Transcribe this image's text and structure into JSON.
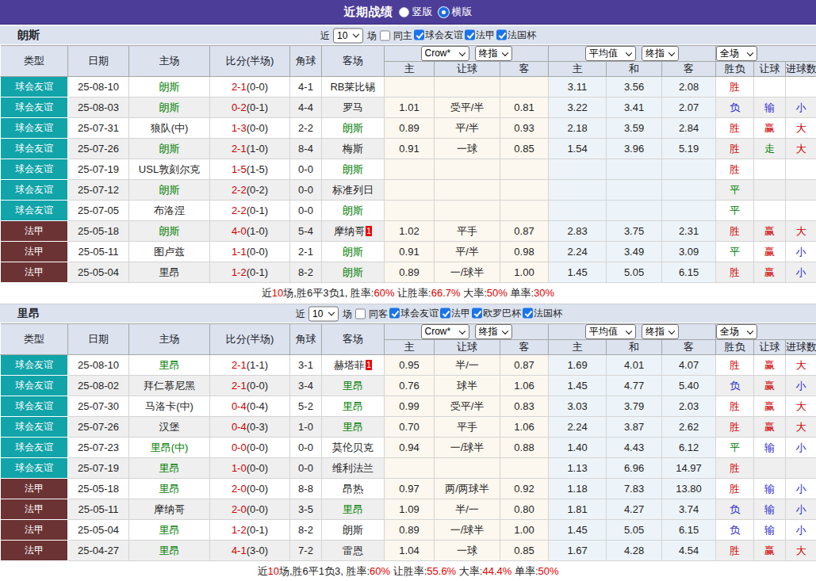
{
  "titlebar": {
    "title": "近期战绩",
    "view_options": [
      {
        "label": "竖版",
        "selected": false
      },
      {
        "label": "横版",
        "selected": true
      }
    ]
  },
  "table": {
    "headers_left": [
      "类型",
      "日期",
      "主场",
      "比分(半场)",
      "角球",
      "客场"
    ],
    "group1_selects": [
      "Crow*",
      "终指"
    ],
    "group1_labels": [
      "主",
      "让球",
      "客"
    ],
    "group2_selects": [
      "平均值",
      "终指"
    ],
    "group2_labels": [
      "主",
      "和",
      "客"
    ],
    "group3_selects": [
      "全场"
    ],
    "group3_labels": [
      "胜负",
      "让球",
      "进球数"
    ]
  },
  "filter_labels": {
    "recent": "近",
    "matches": "场",
    "count_value": "10"
  },
  "colors": {
    "accent_purple": "#4c3d99",
    "friendly_teal": "#11a4a9",
    "league_maroon": "#6c3334",
    "win_red": "#cf0000",
    "draw_green": "#008000",
    "lose_blue": "#2a2ad0",
    "highlight_team_green": "#008000",
    "rank_badge_red": "#ee0000",
    "checkbox_blue": "#1a73e8"
  },
  "sections": [
    {
      "team": "朗斯",
      "filters": {
        "same_label": "同主",
        "same_checked": false,
        "leagues": [
          {
            "label": "球会友谊",
            "checked": true
          },
          {
            "label": "法甲",
            "checked": true
          },
          {
            "label": "法国杯",
            "checked": true
          }
        ]
      },
      "rows": [
        {
          "type": "球会友谊",
          "type_key": "friendly",
          "date": "25-08-10",
          "home": "朗斯",
          "home_hl": true,
          "home_rank": "",
          "ft": "2-1",
          "ht": "(0-0)",
          "corner": "4-1",
          "away": "RB莱比锡",
          "away_hl": false,
          "away_rank": "",
          "ah": [
            "",
            "",
            ""
          ],
          "eu": [
            "3.11",
            "3.56",
            "2.08"
          ],
          "res": "胜",
          "res_k": "r",
          "ah_res": "",
          "ah_res_k": "",
          "ou_res": "",
          "ou_res_k": ""
        },
        {
          "type": "球会友谊",
          "type_key": "friendly",
          "date": "25-08-03",
          "home": "朗斯",
          "home_hl": true,
          "home_rank": "",
          "ft": "0-2",
          "ht": "(0-1)",
          "corner": "4-4",
          "away": "罗马",
          "away_hl": false,
          "away_rank": "",
          "ah": [
            "1.01",
            "受平/半",
            "0.81"
          ],
          "eu": [
            "3.22",
            "3.41",
            "2.07"
          ],
          "res": "负",
          "res_k": "b",
          "ah_res": "输",
          "ah_res_k": "b",
          "ou_res": "小",
          "ou_res_k": "b"
        },
        {
          "type": "球会友谊",
          "type_key": "friendly",
          "date": "25-07-31",
          "home": "狼队(中)",
          "home_hl": false,
          "home_rank": "",
          "ft": "1-3",
          "ht": "(0-0)",
          "corner": "2-2",
          "away": "朗斯",
          "away_hl": true,
          "away_rank": "",
          "ah": [
            "0.89",
            "平/半",
            "0.93"
          ],
          "eu": [
            "2.18",
            "3.59",
            "2.84"
          ],
          "res": "胜",
          "res_k": "r",
          "ah_res": "赢",
          "ah_res_k": "r",
          "ou_res": "大",
          "ou_res_k": "r"
        },
        {
          "type": "球会友谊",
          "type_key": "friendly",
          "date": "25-07-26",
          "home": "朗斯",
          "home_hl": true,
          "home_rank": "",
          "ft": "2-1",
          "ht": "(1-0)",
          "corner": "8-4",
          "away": "梅斯",
          "away_hl": false,
          "away_rank": "",
          "ah": [
            "0.91",
            "一球",
            "0.85"
          ],
          "eu": [
            "1.54",
            "3.96",
            "5.19"
          ],
          "res": "胜",
          "res_k": "r",
          "ah_res": "走",
          "ah_res_k": "g",
          "ou_res": "大",
          "ou_res_k": "r"
        },
        {
          "type": "球会友谊",
          "type_key": "friendly",
          "date": "25-07-19",
          "home": "USL敦刻尔克",
          "home_hl": false,
          "home_rank": "",
          "ft": "1-5",
          "ht": "(1-5)",
          "corner": "0-0",
          "away": "朗斯",
          "away_hl": true,
          "away_rank": "",
          "ah": [
            "",
            "",
            ""
          ],
          "eu": [
            "",
            "",
            ""
          ],
          "res": "胜",
          "res_k": "r",
          "ah_res": "",
          "ah_res_k": "",
          "ou_res": "",
          "ou_res_k": ""
        },
        {
          "type": "球会友谊",
          "type_key": "friendly",
          "date": "25-07-12",
          "home": "朗斯",
          "home_hl": true,
          "home_rank": "",
          "ft": "2-2",
          "ht": "(0-2)",
          "corner": "0-0",
          "away": "标准列日",
          "away_hl": false,
          "away_rank": "",
          "ah": [
            "",
            "",
            ""
          ],
          "eu": [
            "",
            "",
            ""
          ],
          "res": "平",
          "res_k": "g",
          "ah_res": "",
          "ah_res_k": "",
          "ou_res": "",
          "ou_res_k": ""
        },
        {
          "type": "球会友谊",
          "type_key": "friendly",
          "date": "25-07-05",
          "home": "布洛涅",
          "home_hl": false,
          "home_rank": "",
          "ft": "2-2",
          "ht": "(0-1)",
          "corner": "0-0",
          "away": "朗斯",
          "away_hl": true,
          "away_rank": "",
          "ah": [
            "",
            "",
            ""
          ],
          "eu": [
            "",
            "",
            ""
          ],
          "res": "平",
          "res_k": "g",
          "ah_res": "",
          "ah_res_k": "",
          "ou_res": "",
          "ou_res_k": ""
        },
        {
          "type": "法甲",
          "type_key": "league",
          "date": "25-05-18",
          "home": "朗斯",
          "home_hl": true,
          "home_rank": "",
          "ft": "4-0",
          "ht": "(1-0)",
          "corner": "5-4",
          "away": "摩纳哥",
          "away_hl": false,
          "away_rank": "1",
          "ah": [
            "1.02",
            "平手",
            "0.87"
          ],
          "eu": [
            "2.83",
            "3.75",
            "2.31"
          ],
          "res": "胜",
          "res_k": "r",
          "ah_res": "赢",
          "ah_res_k": "r",
          "ou_res": "大",
          "ou_res_k": "r"
        },
        {
          "type": "法甲",
          "type_key": "league",
          "date": "25-05-11",
          "home": "图卢兹",
          "home_hl": false,
          "home_rank": "",
          "ft": "1-1",
          "ht": "(0-0)",
          "corner": "2-1",
          "away": "朗斯",
          "away_hl": true,
          "away_rank": "",
          "ah": [
            "0.91",
            "平/半",
            "0.98"
          ],
          "eu": [
            "2.24",
            "3.49",
            "3.09"
          ],
          "res": "平",
          "res_k": "g",
          "ah_res": "赢",
          "ah_res_k": "r",
          "ou_res": "小",
          "ou_res_k": "b"
        },
        {
          "type": "法甲",
          "type_key": "league",
          "date": "25-05-04",
          "home": "里昂",
          "home_hl": false,
          "home_rank": "",
          "ft": "1-2",
          "ht": "(0-1)",
          "corner": "8-2",
          "away": "朗斯",
          "away_hl": true,
          "away_rank": "",
          "ah": [
            "0.89",
            "一/球半",
            "1.00"
          ],
          "eu": [
            "1.45",
            "5.05",
            "6.15"
          ],
          "res": "胜",
          "res_k": "r",
          "ah_res": "赢",
          "ah_res_k": "r",
          "ou_res": "小",
          "ou_res_k": "b"
        }
      ],
      "summary": [
        {
          "text": "近",
          "red": false
        },
        {
          "text": "10",
          "red": true
        },
        {
          "text": "场,胜6平3负1, 胜率:",
          "red": false
        },
        {
          "text": "60%",
          "red": true
        },
        {
          "text": " 让胜率:",
          "red": false
        },
        {
          "text": "66.7%",
          "red": true
        },
        {
          "text": " 大率:",
          "red": false
        },
        {
          "text": "50%",
          "red": true
        },
        {
          "text": " 单率:",
          "red": false
        },
        {
          "text": "30%",
          "red": true
        }
      ]
    },
    {
      "team": "里昂",
      "filters": {
        "same_label": "同客",
        "same_checked": false,
        "leagues": [
          {
            "label": "球会友谊",
            "checked": true
          },
          {
            "label": "法甲",
            "checked": true
          },
          {
            "label": "欧罗巴杯",
            "checked": true
          },
          {
            "label": "法国杯",
            "checked": true
          }
        ]
      },
      "rows": [
        {
          "type": "球会友谊",
          "type_key": "friendly",
          "date": "25-08-10",
          "home": "里昂",
          "home_hl": true,
          "home_rank": "",
          "ft": "2-1",
          "ht": "(1-1)",
          "corner": "3-1",
          "away": "赫塔菲",
          "away_hl": false,
          "away_rank": "1",
          "ah": [
            "0.95",
            "半/一",
            "0.87"
          ],
          "eu": [
            "1.69",
            "4.01",
            "4.07"
          ],
          "res": "胜",
          "res_k": "r",
          "ah_res": "赢",
          "ah_res_k": "r",
          "ou_res": "大",
          "ou_res_k": "r"
        },
        {
          "type": "球会友谊",
          "type_key": "friendly",
          "date": "25-08-02",
          "home": "拜仁慕尼黑",
          "home_hl": false,
          "home_rank": "",
          "ft": "2-1",
          "ht": "(0-0)",
          "corner": "3-4",
          "away": "里昂",
          "away_hl": true,
          "away_rank": "",
          "ah": [
            "0.76",
            "球半",
            "1.06"
          ],
          "eu": [
            "1.45",
            "4.77",
            "5.40"
          ],
          "res": "负",
          "res_k": "b",
          "ah_res": "赢",
          "ah_res_k": "r",
          "ou_res": "小",
          "ou_res_k": "b"
        },
        {
          "type": "球会友谊",
          "type_key": "friendly",
          "date": "25-07-30",
          "home": "马洛卡(中)",
          "home_hl": false,
          "home_rank": "",
          "ft": "0-4",
          "ht": "(0-4)",
          "corner": "5-2",
          "away": "里昂",
          "away_hl": true,
          "away_rank": "",
          "ah": [
            "0.99",
            "受平/半",
            "0.83"
          ],
          "eu": [
            "3.03",
            "3.79",
            "2.03"
          ],
          "res": "胜",
          "res_k": "r",
          "ah_res": "赢",
          "ah_res_k": "r",
          "ou_res": "大",
          "ou_res_k": "r"
        },
        {
          "type": "球会友谊",
          "type_key": "friendly",
          "date": "25-07-26",
          "home": "汉堡",
          "home_hl": false,
          "home_rank": "",
          "ft": "0-4",
          "ht": "(0-3)",
          "corner": "1-0",
          "away": "里昂",
          "away_hl": true,
          "away_rank": "",
          "ah": [
            "0.70",
            "平手",
            "1.06"
          ],
          "eu": [
            "2.24",
            "3.87",
            "2.62"
          ],
          "res": "胜",
          "res_k": "r",
          "ah_res": "赢",
          "ah_res_k": "r",
          "ou_res": "大",
          "ou_res_k": "r"
        },
        {
          "type": "球会友谊",
          "type_key": "friendly",
          "date": "25-07-23",
          "home": "里昂(中)",
          "home_hl": true,
          "home_rank": "",
          "ft": "0-0",
          "ht": "(0-0)",
          "corner": "0-0",
          "away": "莫伦贝克",
          "away_hl": false,
          "away_rank": "",
          "ah": [
            "0.94",
            "一/球半",
            "0.88"
          ],
          "eu": [
            "1.40",
            "4.43",
            "6.12"
          ],
          "res": "平",
          "res_k": "g",
          "ah_res": "输",
          "ah_res_k": "b",
          "ou_res": "小",
          "ou_res_k": "b"
        },
        {
          "type": "球会友谊",
          "type_key": "friendly",
          "date": "25-07-19",
          "home": "里昂",
          "home_hl": true,
          "home_rank": "",
          "ft": "1-0",
          "ht": "(0-0)",
          "corner": "0-0",
          "away": "维利法兰",
          "away_hl": false,
          "away_rank": "",
          "ah": [
            "",
            "",
            ""
          ],
          "eu": [
            "1.13",
            "6.96",
            "14.97"
          ],
          "res": "胜",
          "res_k": "r",
          "ah_res": "",
          "ah_res_k": "",
          "ou_res": "",
          "ou_res_k": ""
        },
        {
          "type": "法甲",
          "type_key": "league",
          "date": "25-05-18",
          "home": "里昂",
          "home_hl": true,
          "home_rank": "",
          "ft": "2-0",
          "ht": "(0-0)",
          "corner": "8-8",
          "away": "昂热",
          "away_hl": false,
          "away_rank": "",
          "ah": [
            "0.97",
            "两/两球半",
            "0.92"
          ],
          "eu": [
            "1.18",
            "7.83",
            "13.80"
          ],
          "res": "胜",
          "res_k": "r",
          "ah_res": "输",
          "ah_res_k": "b",
          "ou_res": "小",
          "ou_res_k": "b"
        },
        {
          "type": "法甲",
          "type_key": "league",
          "date": "25-05-11",
          "home": "摩纳哥",
          "home_hl": false,
          "home_rank": "",
          "ft": "2-0",
          "ht": "(0-0)",
          "corner": "3-5",
          "away": "里昂",
          "away_hl": true,
          "away_rank": "",
          "ah": [
            "1.09",
            "半/一",
            "0.80"
          ],
          "eu": [
            "1.81",
            "4.27",
            "3.74"
          ],
          "res": "负",
          "res_k": "b",
          "ah_res": "输",
          "ah_res_k": "b",
          "ou_res": "小",
          "ou_res_k": "b"
        },
        {
          "type": "法甲",
          "type_key": "league",
          "date": "25-05-04",
          "home": "里昂",
          "home_hl": true,
          "home_rank": "",
          "ft": "1-2",
          "ht": "(0-1)",
          "corner": "8-2",
          "away": "朗斯",
          "away_hl": false,
          "away_rank": "",
          "ah": [
            "0.89",
            "一/球半",
            "1.00"
          ],
          "eu": [
            "1.45",
            "5.05",
            "6.15"
          ],
          "res": "负",
          "res_k": "b",
          "ah_res": "输",
          "ah_res_k": "b",
          "ou_res": "小",
          "ou_res_k": "b"
        },
        {
          "type": "法甲",
          "type_key": "league",
          "date": "25-04-27",
          "home": "里昂",
          "home_hl": true,
          "home_rank": "",
          "ft": "4-1",
          "ht": "(3-0)",
          "corner": "7-2",
          "away": "雷恩",
          "away_hl": false,
          "away_rank": "",
          "ah": [
            "1.04",
            "一球",
            "0.85"
          ],
          "eu": [
            "1.67",
            "4.28",
            "4.54"
          ],
          "res": "胜",
          "res_k": "r",
          "ah_res": "赢",
          "ah_res_k": "r",
          "ou_res": "大",
          "ou_res_k": "r"
        }
      ],
      "summary": [
        {
          "text": "近",
          "red": false
        },
        {
          "text": "10",
          "red": true
        },
        {
          "text": "场,胜6平1负3, 胜率:",
          "red": false
        },
        {
          "text": "60%",
          "red": true
        },
        {
          "text": " 让胜率:",
          "red": false
        },
        {
          "text": "55.6%",
          "red": true
        },
        {
          "text": " 大率:",
          "red": false
        },
        {
          "text": "44.4%",
          "red": true
        },
        {
          "text": " 单率:",
          "red": false
        },
        {
          "text": "50%",
          "red": true
        }
      ]
    }
  ]
}
